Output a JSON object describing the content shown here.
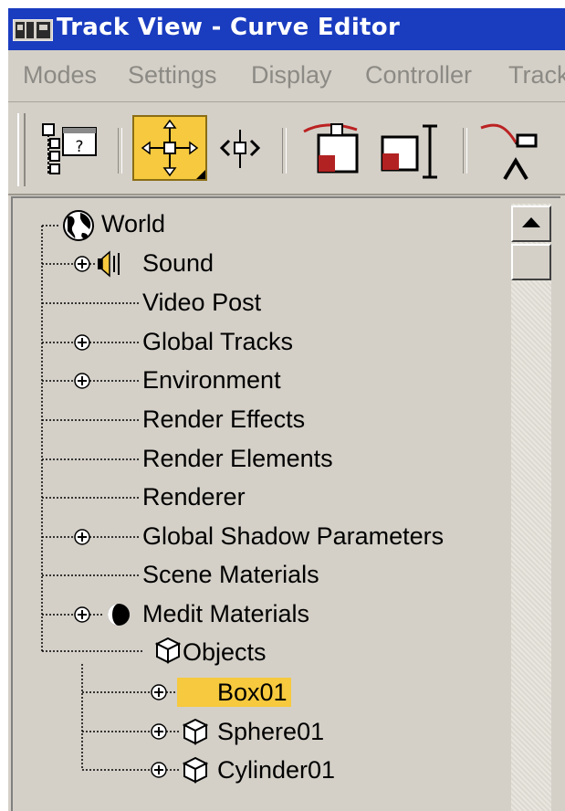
{
  "window": {
    "title": "Track View - Curve Editor"
  },
  "menubar": {
    "items": [
      "Modes",
      "Settings",
      "Display",
      "Controller",
      "Track"
    ]
  },
  "toolbar": {
    "buttons": [
      {
        "icon": "hierarchy-icon",
        "active": false
      },
      {
        "icon": "move-keys-icon",
        "active": true
      },
      {
        "icon": "slide-keys-icon",
        "active": false
      },
      {
        "icon": "scale-keys-icon",
        "active": false
      },
      {
        "icon": "scale-values-icon",
        "active": false
      },
      {
        "icon": "add-keys-icon",
        "active": false
      }
    ]
  },
  "tree": {
    "root": "World",
    "nodes": [
      {
        "label": "Sound",
        "expandable": true,
        "icon": "speaker-icon"
      },
      {
        "label": "Video Post",
        "expandable": false
      },
      {
        "label": "Global Tracks",
        "expandable": true
      },
      {
        "label": "Environment",
        "expandable": true
      },
      {
        "label": "Render Effects",
        "expandable": false
      },
      {
        "label": "Render Elements",
        "expandable": false
      },
      {
        "label": "Renderer",
        "expandable": false
      },
      {
        "label": "Global Shadow Parameters",
        "expandable": true
      },
      {
        "label": "Scene Materials",
        "expandable": false
      },
      {
        "label": "Medit Materials",
        "expandable": true,
        "icon": "material-sphere-icon"
      },
      {
        "label": "Objects",
        "expandable": false,
        "icon": "object-cube-icon"
      }
    ],
    "objects": [
      {
        "label": "Box01",
        "selected": true
      },
      {
        "label": "Sphere01",
        "selected": false
      },
      {
        "label": "Cylinder01",
        "selected": false
      }
    ]
  },
  "colors": {
    "title_bar": "#1a3cbf",
    "selection": "#f6c93e",
    "panel": "#d4d0c8"
  }
}
